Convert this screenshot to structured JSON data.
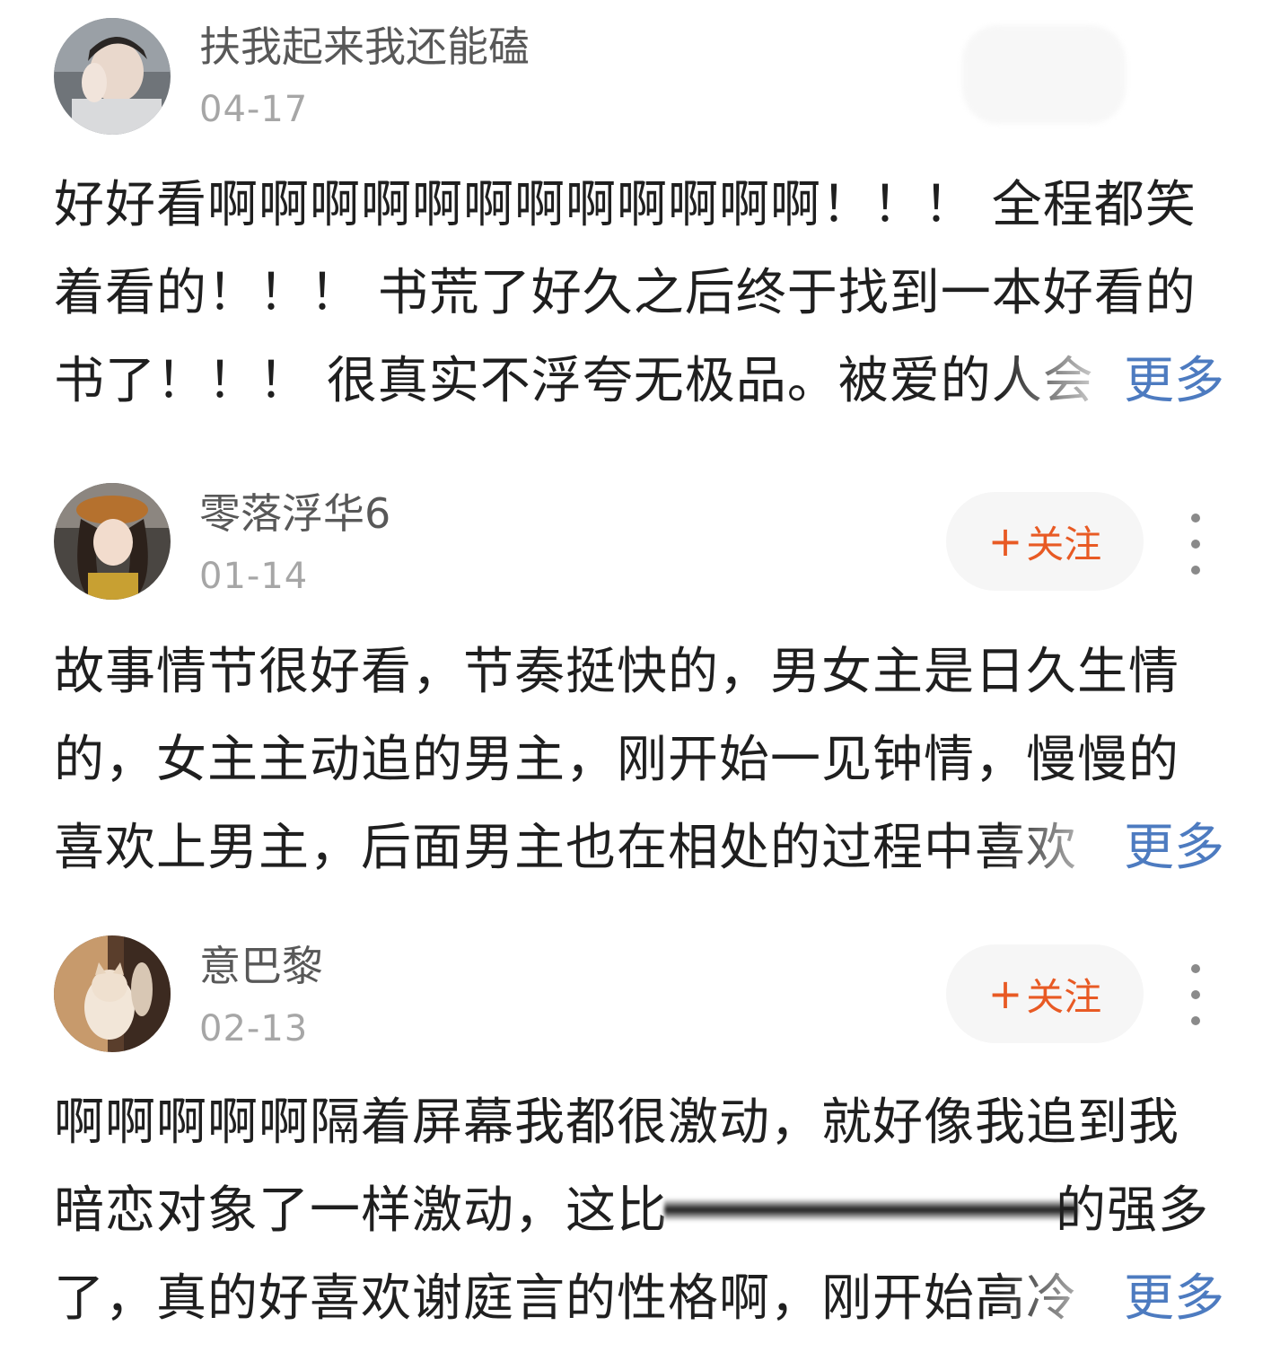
{
  "comments": [
    {
      "username": "扶我起来我还能磕",
      "date": "04-17",
      "lines": [
        "好好看啊啊啊啊啊啊啊啊啊啊啊啊！！！ 全程都笑",
        "着看的！！！ 书荒了好久之后终于找到一本好看的",
        "书了！！！ 很真实不浮夸无极品。被爱的人会"
      ],
      "more_label": "更多"
    },
    {
      "username": "零落浮华6",
      "date": "01-14",
      "follow_plus": "+",
      "follow_label": "关注",
      "lines": [
        "故事情节很好看，节奏挺快的，男女主是日久生情",
        "的，女主主动追的男主，刚开始一见钟情，慢慢的",
        "喜欢上男主，后面男主也在相处的过程中喜欢"
      ],
      "more_label": "更多"
    },
    {
      "username": "意巴黎",
      "date": "02-13",
      "follow_plus": "+",
      "follow_label": "关注",
      "lines": [
        "啊啊啊啊啊隔着屏幕我都很激动，就好像我追到我",
        "暗恋对象了一样激动，这比",
        "的强多",
        "了，真的好喜欢谢庭言的性格啊，刚开始高冷"
      ],
      "more_label": "更多"
    }
  ]
}
